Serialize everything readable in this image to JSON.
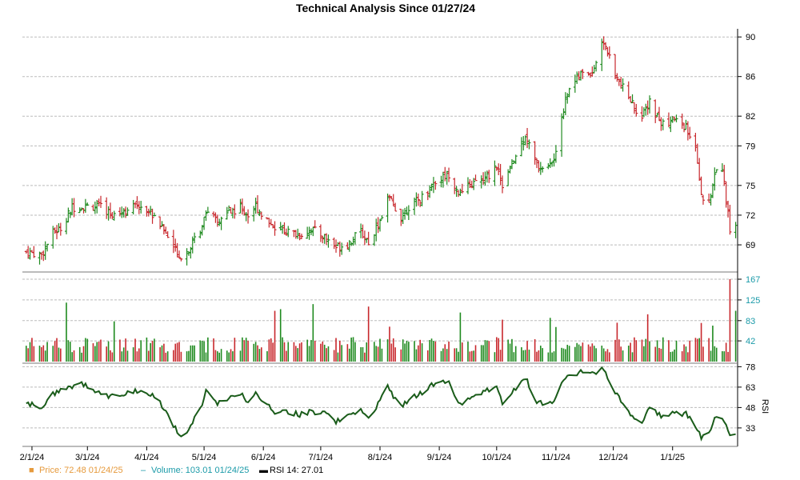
{
  "chart_data": {
    "type": "ohlc",
    "title": "Technical Analysis Since 01/27/24",
    "colors": {
      "up": "#1f8a1f",
      "down": "#c8282d",
      "volume_accent": "#1a9aa8",
      "rsi_line": "#1a5c1a",
      "grid": "#bbbbbb",
      "price_legend": "#e69a3c"
    },
    "price_axis": {
      "ticks": [
        69,
        72,
        75,
        79,
        82,
        86,
        90
      ],
      "range": [
        66.5,
        90.5
      ]
    },
    "volume_axis": {
      "ticks": [
        42,
        83,
        125,
        167
      ],
      "range": [
        0,
        167
      ]
    },
    "rsi_axis": {
      "label": "RSI",
      "ticks": [
        33,
        48,
        63,
        78
      ],
      "range": [
        20,
        80
      ]
    },
    "x_ticks": [
      "2/1/24",
      "3/1/24",
      "4/1/24",
      "5/1/24",
      "6/1/24",
      "7/1/24",
      "8/1/24",
      "9/1/24",
      "10/1/24",
      "11/1/24",
      "12/1/24",
      "1/1/25"
    ],
    "price_anchors": [
      [
        "2024-01-29",
        68.3
      ],
      [
        "2024-02-06",
        68.0
      ],
      [
        "2024-02-12",
        70.2
      ],
      [
        "2024-02-16",
        70.7
      ],
      [
        "2024-02-22",
        72.8
      ],
      [
        "2024-03-01",
        72.9
      ],
      [
        "2024-03-08",
        72.8
      ],
      [
        "2024-03-14",
        72.1
      ],
      [
        "2024-03-21",
        72.5
      ],
      [
        "2024-03-28",
        73.1
      ],
      [
        "2024-04-05",
        72.0
      ],
      [
        "2024-04-12",
        69.8
      ],
      [
        "2024-04-18",
        67.9
      ],
      [
        "2024-04-22",
        68.3
      ],
      [
        "2024-04-29",
        70.5
      ],
      [
        "2024-05-02",
        72.6
      ],
      [
        "2024-05-08",
        71.2
      ],
      [
        "2024-05-14",
        72.3
      ],
      [
        "2024-05-20",
        72.8
      ],
      [
        "2024-05-24",
        72.0
      ],
      [
        "2024-05-28",
        72.9
      ],
      [
        "2024-06-03",
        71.5
      ],
      [
        "2024-06-07",
        70.8
      ],
      [
        "2024-06-14",
        70.3
      ],
      [
        "2024-06-20",
        70.0
      ],
      [
        "2024-06-26",
        70.6
      ],
      [
        "2024-07-03",
        69.8
      ],
      [
        "2024-07-09",
        68.8
      ],
      [
        "2024-07-15",
        69.1
      ],
      [
        "2024-07-22",
        70.3
      ],
      [
        "2024-07-26",
        69.3
      ],
      [
        "2024-08-01",
        71.5
      ],
      [
        "2024-08-05",
        73.8
      ],
      [
        "2024-08-12",
        71.8
      ],
      [
        "2024-08-16",
        72.9
      ],
      [
        "2024-08-22",
        73.6
      ],
      [
        "2024-08-29",
        75.3
      ],
      [
        "2024-09-06",
        76.2
      ],
      [
        "2024-09-12",
        74.0
      ],
      [
        "2024-09-18",
        75.1
      ],
      [
        "2024-09-25",
        75.6
      ],
      [
        "2024-10-01",
        77.0
      ],
      [
        "2024-10-04",
        75.0
      ],
      [
        "2024-10-10",
        77.5
      ],
      [
        "2024-10-16",
        80.2
      ],
      [
        "2024-10-22",
        77.0
      ],
      [
        "2024-10-28",
        76.8
      ],
      [
        "2024-11-01",
        78.0
      ],
      [
        "2024-11-04",
        82.1
      ],
      [
        "2024-11-08",
        85.0
      ],
      [
        "2024-11-14",
        86.2
      ],
      [
        "2024-11-20",
        86.5
      ],
      [
        "2024-11-26",
        89.6
      ],
      [
        "2024-12-02",
        86.0
      ],
      [
        "2024-12-06",
        84.8
      ],
      [
        "2024-12-11",
        83.3
      ],
      [
        "2024-12-16",
        81.8
      ],
      [
        "2024-12-20",
        83.5
      ],
      [
        "2024-12-26",
        81.2
      ],
      [
        "2025-01-02",
        81.6
      ],
      [
        "2025-01-08",
        80.9
      ],
      [
        "2025-01-13",
        78.5
      ],
      [
        "2025-01-16",
        73.8
      ],
      [
        "2025-01-21",
        73.6
      ],
      [
        "2025-01-23",
        76.4
      ],
      [
        "2025-01-27",
        76.7
      ],
      [
        "2025-01-31",
        70.5
      ],
      [
        "2025-02-03",
        71.2
      ]
    ],
    "rsi_anchors": [
      [
        "2024-01-29",
        51
      ],
      [
        "2024-02-06",
        48
      ],
      [
        "2024-02-12",
        58
      ],
      [
        "2024-02-20",
        62
      ],
      [
        "2024-02-26",
        67
      ],
      [
        "2024-03-01",
        64
      ],
      [
        "2024-03-08",
        58
      ],
      [
        "2024-03-14",
        56
      ],
      [
        "2024-03-21",
        59
      ],
      [
        "2024-03-28",
        60
      ],
      [
        "2024-04-05",
        56
      ],
      [
        "2024-04-12",
        44
      ],
      [
        "2024-04-18",
        27
      ],
      [
        "2024-04-22",
        30
      ],
      [
        "2024-04-29",
        47
      ],
      [
        "2024-05-02",
        60
      ],
      [
        "2024-05-08",
        50
      ],
      [
        "2024-05-14",
        56
      ],
      [
        "2024-05-20",
        58
      ],
      [
        "2024-05-24",
        53
      ],
      [
        "2024-05-28",
        59
      ],
      [
        "2024-06-03",
        50
      ],
      [
        "2024-06-07",
        43
      ],
      [
        "2024-06-14",
        45
      ],
      [
        "2024-06-20",
        43
      ],
      [
        "2024-06-26",
        45
      ],
      [
        "2024-07-03",
        44
      ],
      [
        "2024-07-09",
        38
      ],
      [
        "2024-07-15",
        42
      ],
      [
        "2024-07-22",
        47
      ],
      [
        "2024-07-26",
        40
      ],
      [
        "2024-08-01",
        53
      ],
      [
        "2024-08-05",
        63
      ],
      [
        "2024-08-12",
        48
      ],
      [
        "2024-08-16",
        54
      ],
      [
        "2024-08-22",
        58
      ],
      [
        "2024-08-29",
        65
      ],
      [
        "2024-09-06",
        67
      ],
      [
        "2024-09-12",
        50
      ],
      [
        "2024-09-18",
        57
      ],
      [
        "2024-09-25",
        60
      ],
      [
        "2024-10-01",
        63
      ],
      [
        "2024-10-04",
        52
      ],
      [
        "2024-10-10",
        60
      ],
      [
        "2024-10-16",
        70
      ],
      [
        "2024-10-22",
        53
      ],
      [
        "2024-10-28",
        50
      ],
      [
        "2024-11-01",
        56
      ],
      [
        "2024-11-04",
        68
      ],
      [
        "2024-11-08",
        72
      ],
      [
        "2024-11-14",
        74
      ],
      [
        "2024-11-20",
        73
      ],
      [
        "2024-11-26",
        76
      ],
      [
        "2024-12-02",
        60
      ],
      [
        "2024-12-06",
        52
      ],
      [
        "2024-12-11",
        41
      ],
      [
        "2024-12-16",
        38
      ],
      [
        "2024-12-20",
        49
      ],
      [
        "2024-12-26",
        42
      ],
      [
        "2025-01-02",
        44
      ],
      [
        "2025-01-08",
        43
      ],
      [
        "2025-01-13",
        35
      ],
      [
        "2025-01-16",
        25
      ],
      [
        "2025-01-21",
        30
      ],
      [
        "2025-01-23",
        40
      ],
      [
        "2025-01-27",
        41
      ],
      [
        "2025-01-31",
        27
      ],
      [
        "2025-02-03",
        29
      ]
    ],
    "volume_spikes": [
      [
        "2024-02-19",
        42
      ],
      [
        "2024-03-15",
        42
      ],
      [
        "2024-06-07",
        42
      ],
      [
        "2024-06-10",
        42
      ],
      [
        "2024-06-27",
        42
      ],
      [
        "2024-07-26",
        42
      ],
      [
        "2024-08-06",
        42
      ],
      [
        "2024-09-12",
        42
      ],
      [
        "2024-10-04",
        42
      ],
      [
        "2024-10-29",
        42
      ],
      [
        "2024-11-01",
        42
      ],
      [
        "2024-12-03",
        42
      ],
      [
        "2024-12-19",
        42
      ],
      [
        "2025-01-16",
        42
      ],
      [
        "2025-01-22",
        42
      ],
      [
        "2025-01-31",
        42
      ]
    ],
    "legend": [
      {
        "marker": "■",
        "color": "#e69a3c",
        "text": "Price: 72.48  01/24/25"
      },
      {
        "marker": "–",
        "color": "#1a9aa8",
        "text": "Volume: 103.01  01/24/25"
      },
      {
        "marker": "▬",
        "color": "#000000",
        "text": "RSI 14: 27.01"
      }
    ]
  }
}
